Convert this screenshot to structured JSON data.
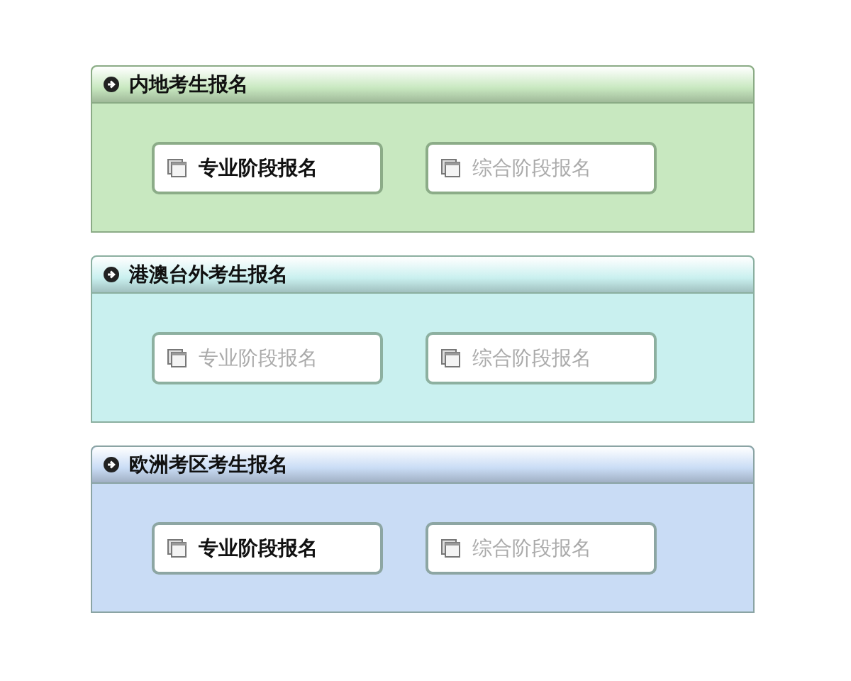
{
  "panels": [
    {
      "title": "内地考生报名",
      "color": "#c8e8c0",
      "buttons": [
        {
          "label": "专业阶段报名",
          "disabled": false
        },
        {
          "label": "综合阶段报名",
          "disabled": true
        }
      ]
    },
    {
      "title": "港澳台外考生报名",
      "color": "#c9f0ef",
      "buttons": [
        {
          "label": "专业阶段报名",
          "disabled": true
        },
        {
          "label": "综合阶段报名",
          "disabled": true
        }
      ]
    },
    {
      "title": "欧洲考区考生报名",
      "color": "#c9dcf5",
      "buttons": [
        {
          "label": "专业阶段报名",
          "disabled": false
        },
        {
          "label": "综合阶段报名",
          "disabled": true
        }
      ]
    }
  ]
}
